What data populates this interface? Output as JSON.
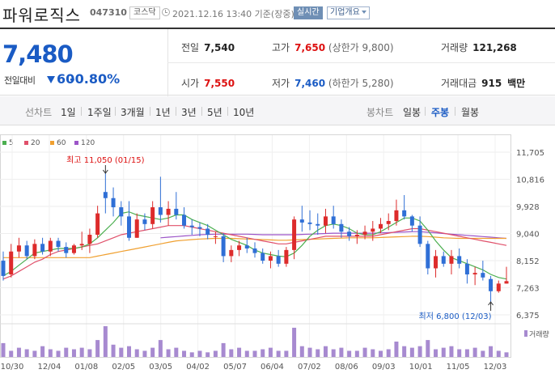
{
  "header": {
    "name": "파워로직스",
    "code": "047310",
    "market": "코스닥",
    "datetime": "2021.12.16 13:40 기준(장중)",
    "realtime": "실시간",
    "corp_info": "기업개요"
  },
  "quote": {
    "price": "7,480",
    "diff_label": "전일대비",
    "diff_value": "60",
    "diff_pct": "-0.80%",
    "prev_label": "전일",
    "prev": "7,540",
    "high_label": "고가",
    "high": "7,650",
    "high_limit": "(상한가 9,800)",
    "volume_label": "거래량",
    "volume": "121,268",
    "open_label": "시가",
    "open": "7,550",
    "low_label": "저가",
    "low": "7,460",
    "low_limit": "(하한가 5,280)",
    "amount_label": "거래대금",
    "amount": "915",
    "amount_unit": "백만"
  },
  "toolbar": {
    "line_label": "선차트",
    "periods": [
      "1일",
      "1주일",
      "3개월",
      "1년",
      "3년",
      "5년",
      "10년"
    ],
    "candle_label": "봉차트",
    "candle": [
      "일봉",
      "주봉",
      "월봉"
    ],
    "selected_candle": "주봉"
  },
  "colors": {
    "up": "#dd2b2b",
    "down": "#2f6fd6",
    "ma5": "#4caf50",
    "ma20": "#e0506a",
    "ma60": "#f0a030",
    "ma120": "#9c55c8",
    "volume": "#a78ad0"
  },
  "chart_data": {
    "type": "candlestick",
    "legend": [
      "5",
      "20",
      "60",
      "120"
    ],
    "y_ticks": [
      "11,705",
      "10,816",
      "9,928",
      "9,040",
      "8,152",
      "7,263",
      "6,375"
    ],
    "y_values": [
      11705,
      10816,
      9928,
      9040,
      8152,
      7263,
      6375
    ],
    "x_ticks": [
      "10/30",
      "12/04",
      "01/08",
      "02/05",
      "03/05",
      "04/02",
      "05/07",
      "06/04",
      "07/02",
      "08/06",
      "09/03",
      "10/01",
      "11/05",
      "12/03"
    ],
    "annotations": {
      "high": "최고 11,050 (01/15)",
      "low": "최저 6,800 (12/03)"
    },
    "volume_label": "거래량",
    "candles": [
      [
        8150,
        8450,
        7500,
        7650
      ],
      [
        7700,
        8700,
        7600,
        8450
      ],
      [
        8450,
        8900,
        8250,
        8650
      ],
      [
        8650,
        8800,
        8200,
        8300
      ],
      [
        8300,
        8850,
        8200,
        8700
      ],
      [
        8700,
        8900,
        8350,
        8450
      ],
      [
        8450,
        8900,
        8300,
        8800
      ],
      [
        8800,
        8900,
        8450,
        8600
      ],
      [
        8600,
        8750,
        8250,
        8400
      ],
      [
        8400,
        8700,
        8350,
        8650
      ],
      [
        8650,
        9100,
        8500,
        8700
      ],
      [
        8700,
        9200,
        8400,
        9000
      ],
      [
        9000,
        9950,
        8900,
        9700
      ],
      [
        10400,
        11050,
        9700,
        10200
      ],
      [
        10200,
        10550,
        9600,
        9900
      ],
      [
        9900,
        10100,
        9300,
        9600
      ],
      [
        9600,
        10100,
        8800,
        8900
      ],
      [
        8900,
        9700,
        8900,
        9500
      ],
      [
        9500,
        9700,
        9150,
        9350
      ],
      [
        9350,
        10100,
        9200,
        9900
      ],
      [
        9900,
        10900,
        9400,
        9650
      ],
      [
        9650,
        10100,
        9300,
        9850
      ],
      [
        9850,
        10400,
        9500,
        9650
      ],
      [
        9650,
        9900,
        9200,
        9300
      ],
      [
        9300,
        9500,
        9000,
        9250
      ],
      [
        9250,
        9400,
        8950,
        9200
      ],
      [
        9200,
        9350,
        8850,
        9000
      ],
      [
        8950,
        9100,
        8700,
        8950
      ],
      [
        8950,
        9050,
        8100,
        8300
      ],
      [
        8300,
        8650,
        8100,
        8500
      ],
      [
        8500,
        8800,
        8300,
        8650
      ],
      [
        8650,
        8900,
        8400,
        8550
      ],
      [
        8550,
        8750,
        8250,
        8400
      ],
      [
        8400,
        8550,
        8050,
        8150
      ],
      [
        8150,
        8450,
        7900,
        8300
      ],
      [
        8300,
        8500,
        7950,
        8050
      ],
      [
        8050,
        8600,
        7950,
        8500
      ],
      [
        8500,
        9600,
        8200,
        9500
      ],
      [
        9500,
        9950,
        9100,
        9400
      ],
      [
        9400,
        9800,
        9150,
        9350
      ],
      [
        9350,
        9700,
        9000,
        9300
      ],
      [
        9300,
        9850,
        9050,
        9600
      ],
      [
        9600,
        9950,
        9200,
        9350
      ],
      [
        9350,
        9500,
        8900,
        9100
      ],
      [
        9100,
        9250,
        8800,
        8950
      ],
      [
        8950,
        9150,
        8700,
        9000
      ],
      [
        9000,
        9300,
        8850,
        9100
      ],
      [
        9100,
        9450,
        8800,
        9200
      ],
      [
        9200,
        9550,
        9050,
        9350
      ],
      [
        9350,
        9700,
        9150,
        9450
      ],
      [
        9450,
        10150,
        9300,
        9800
      ],
      [
        9800,
        10300,
        9500,
        9600
      ],
      [
        9600,
        9650,
        9100,
        9300
      ],
      [
        9300,
        9600,
        8600,
        8700
      ],
      [
        8700,
        8800,
        7700,
        7900
      ],
      [
        7900,
        8500,
        7600,
        8300
      ],
      [
        8300,
        8450,
        7950,
        8050
      ],
      [
        8050,
        8500,
        7700,
        8300
      ],
      [
        8300,
        8550,
        7900,
        8050
      ],
      [
        8050,
        8200,
        7400,
        7700
      ],
      [
        7700,
        7950,
        7350,
        7750
      ],
      [
        7750,
        8150,
        7500,
        7600
      ],
      [
        7550,
        7650,
        6800,
        7150
      ],
      [
        7150,
        7500,
        7100,
        7400
      ],
      [
        7400,
        7950,
        7400,
        7480
      ]
    ],
    "ma5": [
      7650,
      7800,
      8000,
      8200,
      8400,
      8450,
      8500,
      8550,
      8550,
      8550,
      8600,
      8700,
      8900,
      9150,
      9400,
      9700,
      9750,
      9650,
      9600,
      9550,
      9500,
      9550,
      9650,
      9650,
      9500,
      9400,
      9300,
      9150,
      9000,
      8850,
      8750,
      8650,
      8500,
      8400,
      8350,
      8300,
      8280,
      8400,
      8650,
      8950,
      9150,
      9300,
      9350,
      9300,
      9200,
      9050,
      9000,
      9000,
      9100,
      9250,
      9400,
      9550,
      9550,
      9450,
      9150,
      8800,
      8500,
      8250,
      8150,
      8050,
      7950,
      7850,
      7700,
      7600,
      7550
    ],
    "ma20": [
      7550,
      7650,
      7800,
      7950,
      8100,
      8200,
      8350,
      8450,
      8500,
      8550,
      8600,
      8650,
      8700,
      8800,
      8900,
      9000,
      9050,
      9100,
      9150,
      9200,
      9250,
      9300,
      9300,
      9300,
      9250,
      9200,
      9150,
      9100,
      9050,
      9000,
      8950,
      8900,
      8850,
      8800,
      8750,
      8700,
      8700,
      8750,
      8800,
      8850,
      8900,
      8950,
      8950,
      8950,
      8950,
      8950,
      8950,
      8950,
      9000,
      9050,
      9100,
      9150,
      9200,
      9200,
      9150,
      9100,
      9050,
      9000,
      8950,
      8900,
      8850,
      8800,
      8750,
      8700,
      8650
    ],
    "ma60": [
      8250,
      8250,
      8250,
      8250,
      8250,
      8250,
      8250,
      8250,
      8250,
      8250,
      8250,
      8250,
      8300,
      8350,
      8400,
      8450,
      8500,
      8550,
      8600,
      8650,
      8700,
      8750,
      8800,
      8820,
      8840,
      8860,
      8870,
      8880,
      8880,
      8880,
      8870,
      8860,
      8850,
      8840,
      8830,
      8820,
      8820,
      8830,
      8840,
      8850,
      8860,
      8870,
      8880,
      8890,
      8900,
      8900,
      8900,
      8900,
      8910,
      8920,
      8930,
      8940,
      8950,
      8950,
      8940,
      8920,
      8900,
      8890,
      8880,
      8880,
      8880,
      8880,
      8880,
      8880,
      8880
    ],
    "ma120": [
      null,
      null,
      null,
      null,
      null,
      null,
      null,
      null,
      null,
      null,
      null,
      null,
      null,
      null,
      null,
      null,
      null,
      null,
      null,
      null,
      8900,
      8920,
      8940,
      8960,
      8980,
      9000,
      9010,
      9020,
      9020,
      9020,
      9020,
      9020,
      9010,
      9000,
      9000,
      9000,
      9000,
      9000,
      9010,
      9020,
      9030,
      9040,
      9050,
      9050,
      9050,
      9050,
      9050,
      9050,
      9060,
      9070,
      9080,
      9090,
      9100,
      9100,
      9080,
      9060,
      9040,
      9020,
      9000,
      8980,
      8960,
      8940,
      8920,
      8900,
      8880
    ],
    "volumes": [
      0.45,
      0.2,
      0.3,
      0.25,
      0.2,
      0.35,
      0.25,
      0.2,
      0.3,
      0.25,
      0.3,
      0.25,
      0.55,
      1.0,
      0.4,
      0.3,
      0.35,
      0.25,
      0.2,
      0.3,
      0.55,
      0.25,
      0.3,
      0.2,
      0.15,
      0.2,
      0.15,
      0.2,
      0.45,
      0.25,
      0.3,
      0.2,
      0.2,
      0.25,
      0.3,
      0.2,
      0.2,
      0.95,
      0.35,
      0.3,
      0.25,
      0.35,
      0.25,
      0.3,
      0.2,
      0.2,
      0.3,
      0.25,
      0.2,
      0.25,
      0.5,
      0.35,
      0.3,
      0.35,
      0.55,
      0.25,
      0.3,
      0.35,
      0.25,
      0.25,
      0.3,
      0.2,
      0.35,
      0.2,
      0.15
    ]
  }
}
